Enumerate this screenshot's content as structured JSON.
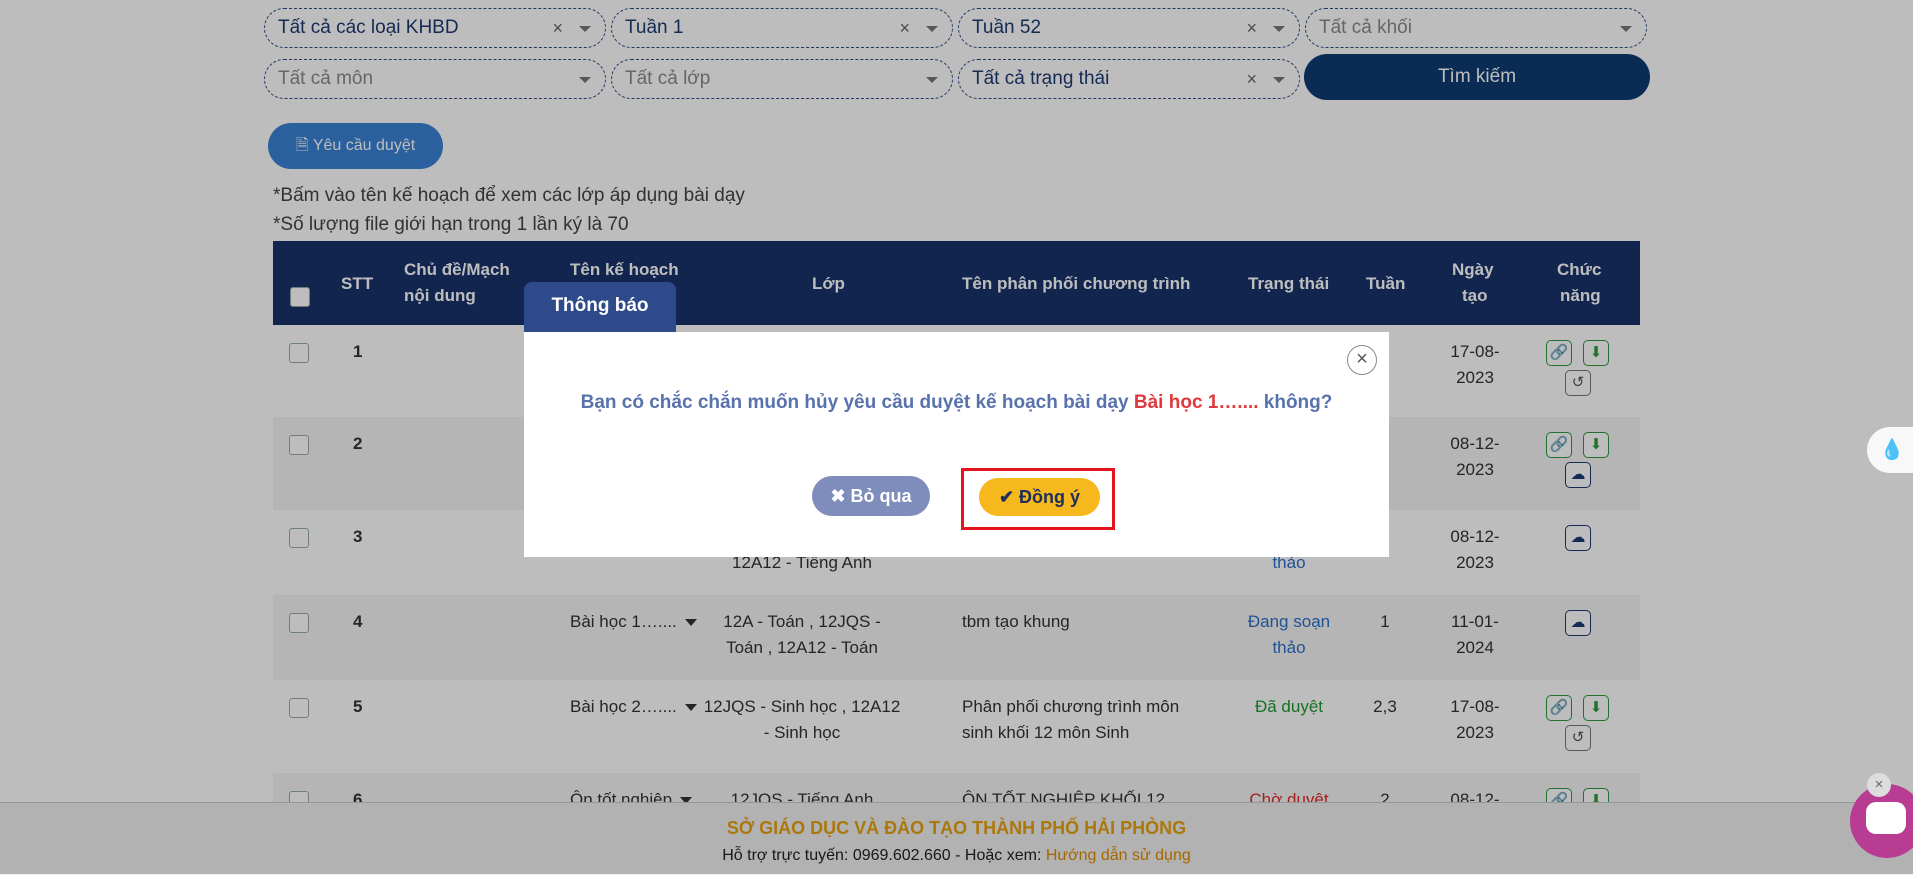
{
  "filters": {
    "khbd": {
      "value": "Tất cả các loại KHBD",
      "clear": "×"
    },
    "tuan_from": {
      "value": "Tuần 1",
      "clear": "×"
    },
    "tuan_to": {
      "value": "Tuần 52",
      "clear": "×"
    },
    "khoi": {
      "placeholder": "Tất cả khối"
    },
    "mon": {
      "placeholder": "Tất cả môn"
    },
    "lop": {
      "placeholder": "Tất cả lớp"
    },
    "trang_thai": {
      "value": "Tất cả trạng thái",
      "clear": "×"
    },
    "search_label": "Tìm kiếm"
  },
  "request_button": {
    "icon": "file-icon",
    "label": "Yêu cầu duyệt"
  },
  "notes": [
    "*Bấm vào tên kế hoạch để xem các lớp áp dụng bài dạy",
    "*Số lượng file giới hạn trong 1 lần ký là 70"
  ],
  "table": {
    "headers": {
      "stt": "STT",
      "chu_de_1": "Chủ đề/Mạch",
      "chu_de_2": "nội dung",
      "ten_ke_hoach": "Tên kế hoạch",
      "lop": "Lớp",
      "ten_ppct": "Tên phân phối chương trình",
      "trang_thai": "Trạng thái",
      "tuan": "Tuần",
      "ngay_tao_1": "Ngày",
      "ngay_tao_2": "tạo",
      "chuc_nang_1": "Chức",
      "chuc_nang_2": "năng"
    },
    "rows": [
      {
        "stt": "1",
        "ngay1": "17-08-",
        "ngay2": "2023"
      },
      {
        "stt": "2",
        "ngay1": "08-12-",
        "ngay2": "2023"
      },
      {
        "stt": "3",
        "lop2": "12A12 - Tiếng Anh",
        "trang_thai2": "thảo",
        "ngay1": "08-12-",
        "ngay2": "2023"
      },
      {
        "stt": "4",
        "ten": "Bài học 1…....",
        "lop1": "12A - Toán , 12JQS -",
        "lop2": "Toán , 12A12 - Toán",
        "ppct1": "tbm tạo khung",
        "trang_thai1": "Đang soạn",
        "trang_thai2": "thảo",
        "tuan": "1",
        "ngay1": "11-01-",
        "ngay2": "2024"
      },
      {
        "stt": "5",
        "ten": "Bài học 2…....",
        "lop1": "12JQS - Sinh học , 12A12",
        "lop2": "- Sinh học",
        "ppct1": "Phân phối chương trình môn",
        "ppct2": "sinh khối 12 môn Sinh",
        "trang_thai1": "Đã duyệt",
        "tuan": "2,3",
        "ngay1": "17-08-",
        "ngay2": "2023"
      },
      {
        "stt": "6",
        "ten": "Ôn tốt nghiệp",
        "lop1": "12JQS - Tiếng Anh",
        "ppct1": "ÔN TỐT NGHIỆP KHỐI 12",
        "trang_thai1": "Chờ duyệt",
        "tuan": "2",
        "ngay1": "08-12-"
      }
    ]
  },
  "footer": {
    "org": "SỞ GIÁO DỤC VÀ ĐÀO TẠO THÀNH PHỐ HẢI PHÒNG",
    "support": "Hỗ trợ trực tuyến: 0969.602.660 - Hoặc xem:",
    "guide_link": "Hướng dẫn sử dụng"
  },
  "modal": {
    "tab_title": "Thông báo",
    "close": "×",
    "question": "Bạn có chắc chắn muốn hủy yêu cầu duyệt kế hoạch bài dạy",
    "plan_name": "Bài học 1…....",
    "question_end": "không?",
    "cancel_label": "Bỏ qua",
    "confirm_label": "Đồng ý"
  },
  "colors": {
    "header_bg": "#17326b",
    "accent_navy": "#0d3b72",
    "confirm": "#f6b81c",
    "highlight": "#e3141d"
  }
}
